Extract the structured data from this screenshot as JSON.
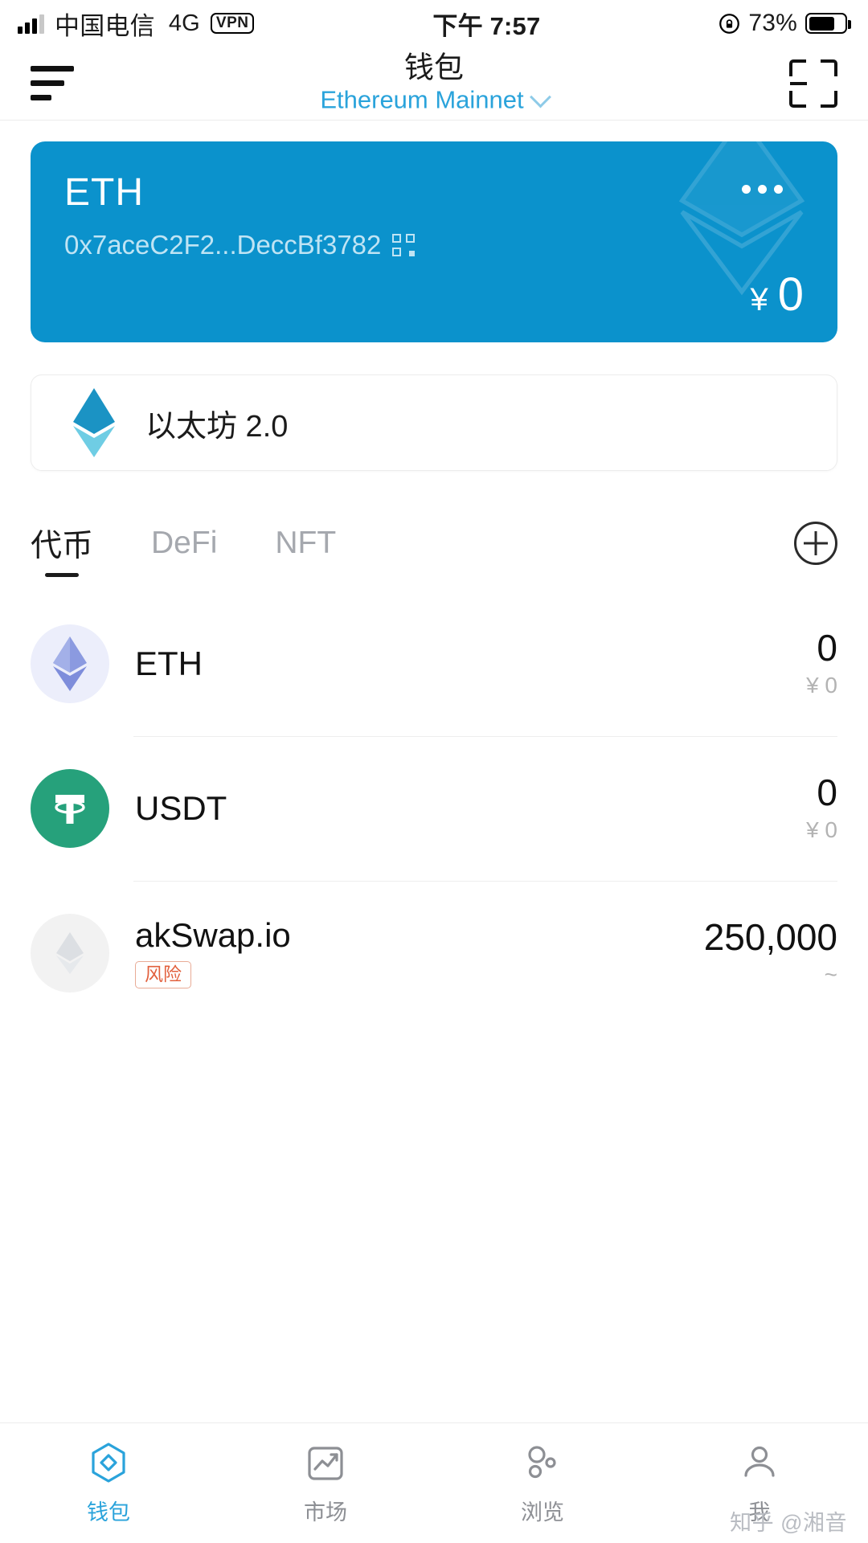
{
  "status_bar": {
    "carrier": "中国电信",
    "network": "4G",
    "vpn_label": "VPN",
    "time": "下午 7:57",
    "battery_percent": "73%",
    "battery_level": 73,
    "signal_bars": 3
  },
  "header": {
    "title": "钱包",
    "network_name": "Ethereum Mainnet",
    "menu_icon": "hamburger-icon",
    "scan_icon": "scan-qr-icon",
    "chevron_icon": "chevron-down-icon"
  },
  "balance_card": {
    "symbol": "ETH",
    "address": "0x7aceC2F2...DeccBf3782",
    "qr_icon": "qr-code-icon",
    "more_icon": "more-dots-icon",
    "currency": "¥",
    "amount": "0",
    "bg_color": "#0b92cc",
    "address_color": "#bfe4f4"
  },
  "promo": {
    "label": "以太坊 2.0",
    "icon": "ethereum-diamond-icon"
  },
  "tabs": {
    "items": [
      {
        "label": "代币",
        "active": true
      },
      {
        "label": "DeFi",
        "active": false
      },
      {
        "label": "NFT",
        "active": false
      }
    ],
    "add_icon": "plus-circle-icon"
  },
  "tokens": [
    {
      "name": "ETH",
      "icon": "ethereum-token-icon",
      "amount": "0",
      "fiat_currency": "¥",
      "fiat_amount": "0",
      "badge": ""
    },
    {
      "name": "USDT",
      "icon": "tether-token-icon",
      "amount": "0",
      "fiat_currency": "¥",
      "fiat_amount": "0",
      "badge": ""
    },
    {
      "name": "akSwap.io",
      "icon": "generic-token-icon",
      "amount": "250,000",
      "fiat_currency": "",
      "fiat_amount": "~",
      "badge": "风险"
    }
  ],
  "tab_bar": {
    "items": [
      {
        "label": "钱包",
        "icon": "wallet-icon",
        "active": true
      },
      {
        "label": "市场",
        "icon": "market-chart-icon",
        "active": false
      },
      {
        "label": "浏览",
        "icon": "browse-bubbles-icon",
        "active": false
      },
      {
        "label": "我",
        "icon": "person-icon",
        "active": false
      }
    ],
    "active_color": "#2aa3db",
    "inactive_color": "#8d8f94"
  },
  "watermark": {
    "text": "知乎 @湘音"
  }
}
